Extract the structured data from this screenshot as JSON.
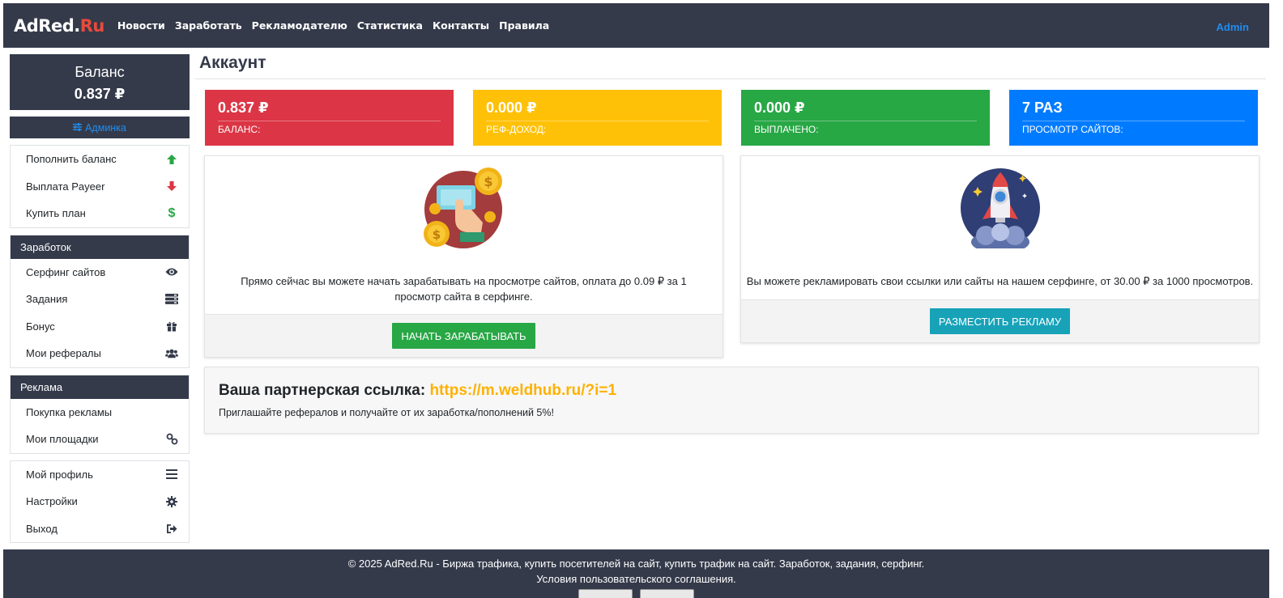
{
  "nav": {
    "brand_main": "AdRed.",
    "brand_accent": "Ru",
    "links": [
      "Новости",
      "Заработать",
      "Рекламодателю",
      "Статистика",
      "Контакты",
      "Правила"
    ],
    "user": "Admin"
  },
  "sidebar": {
    "balance_title": "Баланс",
    "balance_value": "0.837 ₽",
    "admin_label": "Админка",
    "group1": [
      {
        "label": "Пополнить баланс",
        "icon": "arrow-up-icon"
      },
      {
        "label": "Выплата Payeer",
        "icon": "arrow-down-icon"
      },
      {
        "label": "Купить план",
        "icon": "dollar-icon"
      }
    ],
    "group2_title": "Заработок",
    "group2": [
      {
        "label": "Серфинг сайтов",
        "icon": "eye-icon"
      },
      {
        "label": "Задания",
        "icon": "tasks-icon"
      },
      {
        "label": "Бонус",
        "icon": "gift-icon"
      },
      {
        "label": "Мои рефералы",
        "icon": "users-icon"
      }
    ],
    "group3_title": "Реклама",
    "group3": [
      {
        "label": "Покупка рекламы",
        "icon": ""
      },
      {
        "label": "Мои площадки",
        "icon": "link-icon"
      }
    ],
    "group4": [
      {
        "label": "Мой профиль",
        "icon": "bars-icon"
      },
      {
        "label": "Настройки",
        "icon": "gear-icon"
      },
      {
        "label": "Выход",
        "icon": "sign-out-icon"
      }
    ]
  },
  "main": {
    "title": "Аккаунт",
    "stats": [
      {
        "value": "0.837 ₽",
        "label": "Баланс:",
        "color": "#dc3545"
      },
      {
        "value": "0.000 ₽",
        "label": "Реф-доход:",
        "color": "#ffc107"
      },
      {
        "value": "0.000 ₽",
        "label": "Выплачено:",
        "color": "#28a745"
      },
      {
        "value": "7 раз",
        "label": "Просмотр сайтов:",
        "color": "#007bff"
      }
    ],
    "earn_card": {
      "text": "Прямо сейчас вы можете начать зарабатывать на просмотре сайтов, оплата до 0.09 ₽ за 1 просмотр сайта в серфинге.",
      "button": "Начать зарабатывать",
      "button_color": "#28a745",
      "icon": "coins-hand-icon"
    },
    "ad_card": {
      "text": "Вы можете рекламировать свои ссылки или сайты на нашем серфинге, от 30.00 ₽ за 1000 просмотров.",
      "button": "Разместить рекламу",
      "button_color": "#17a2b8",
      "icon": "rocket-icon"
    },
    "referral": {
      "title": "Ваша партнерская ссылка:",
      "link": "https://m.weldhub.ru/?i=1",
      "text": "Приглашайте рефералов и получайте от их заработка/пополнений 5%!"
    }
  },
  "footer": {
    "copyright": "© 2025",
    "brand": "AdRed.Ru",
    "description": "- Биржа трафика, купить посетителей на сайт, купить трафик на сайт. Заработок, задания, серфинг.",
    "terms": "Условия пользовательского соглашения."
  }
}
